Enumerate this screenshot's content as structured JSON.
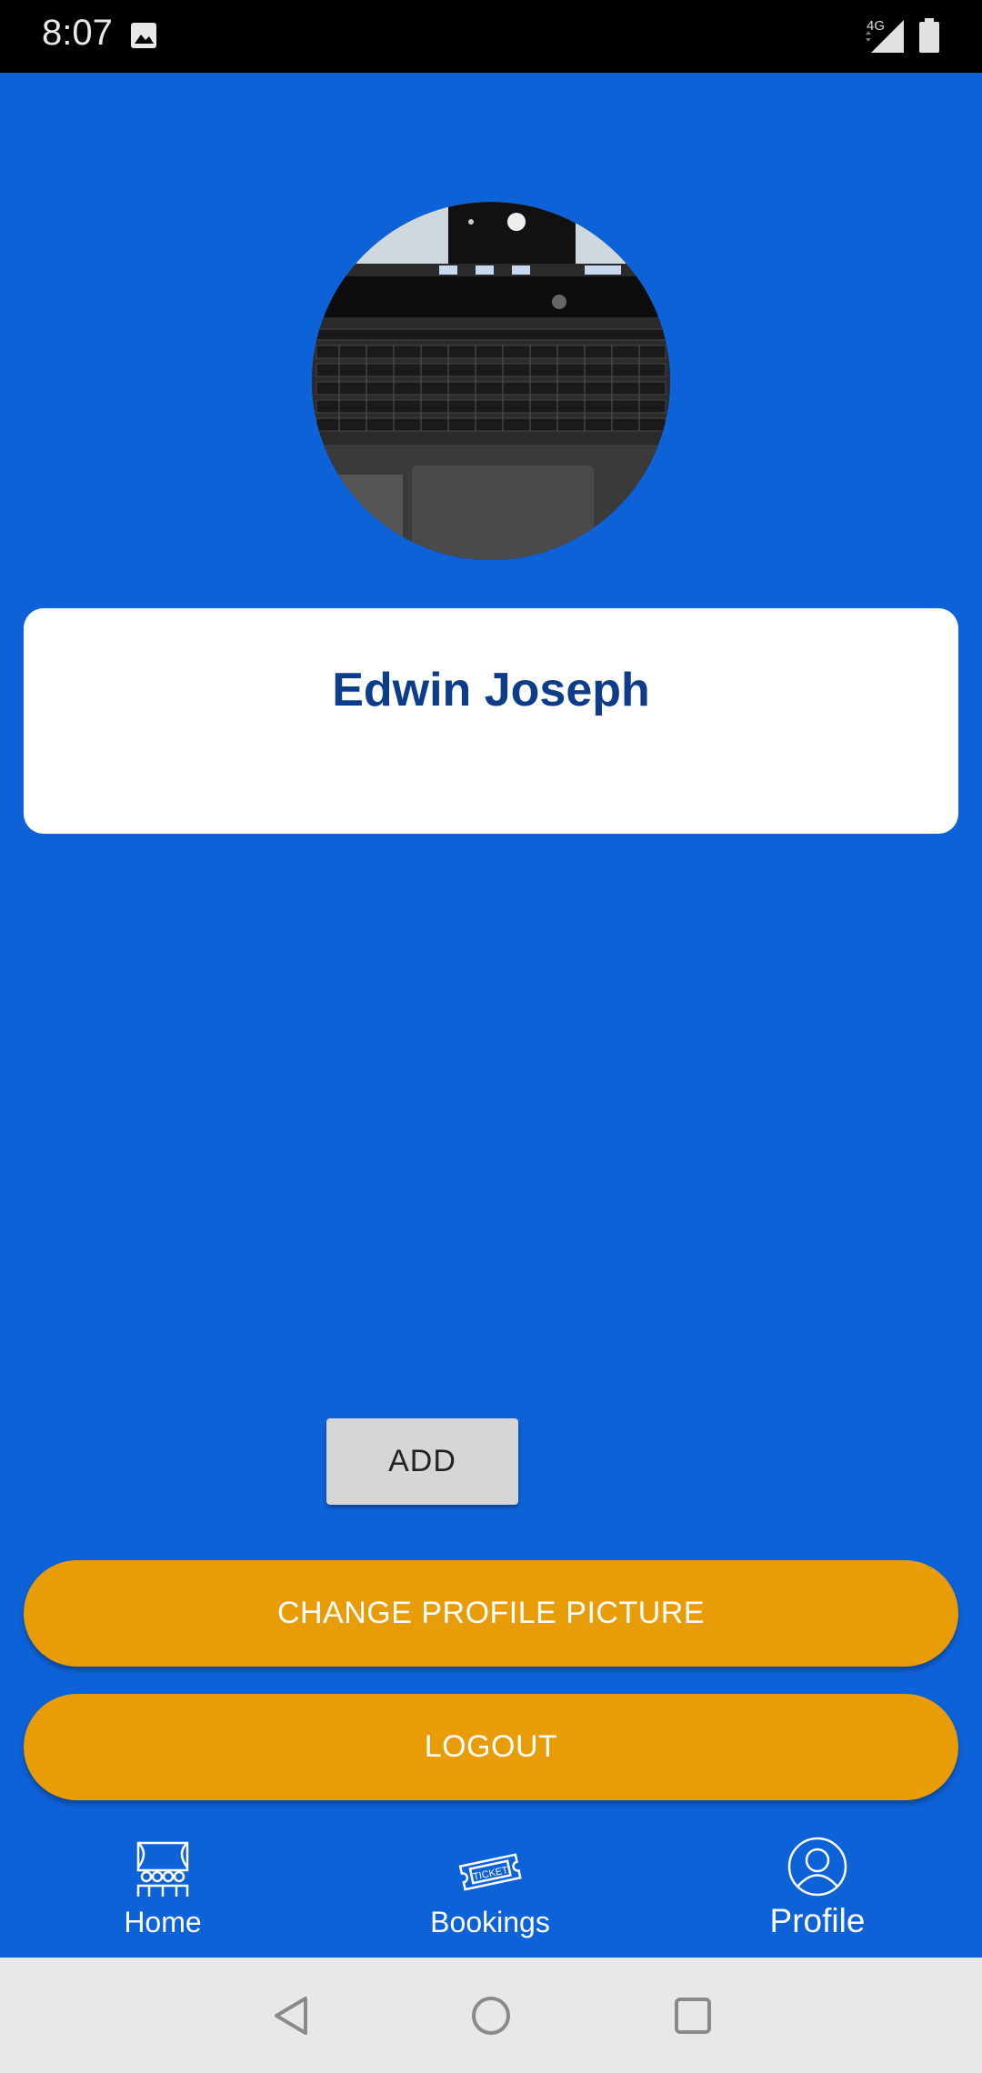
{
  "status_bar": {
    "time": "8:07",
    "network": "4G",
    "icons": [
      "image-icon",
      "signal-icon",
      "battery-icon"
    ]
  },
  "profile": {
    "name": "Edwin Joseph",
    "avatar": "laptop-keyboard-photo"
  },
  "actions": {
    "add_label": "ADD",
    "change_picture_label": "CHANGE PROFILE PICTURE",
    "logout_label": "LOGOUT"
  },
  "bottom_nav": {
    "items": [
      {
        "label": "Home",
        "icon": "theater-icon"
      },
      {
        "label": "Bookings",
        "icon": "ticket-icon"
      },
      {
        "label": "Profile",
        "icon": "user-icon"
      }
    ],
    "selected": "Profile"
  },
  "system_nav": {
    "icons": [
      "back-icon",
      "home-icon",
      "recents-icon"
    ]
  },
  "colors": {
    "background": "#0e62d8",
    "accent": "#e89c08",
    "name_text": "#0d3c8a",
    "card": "#ffffff"
  }
}
